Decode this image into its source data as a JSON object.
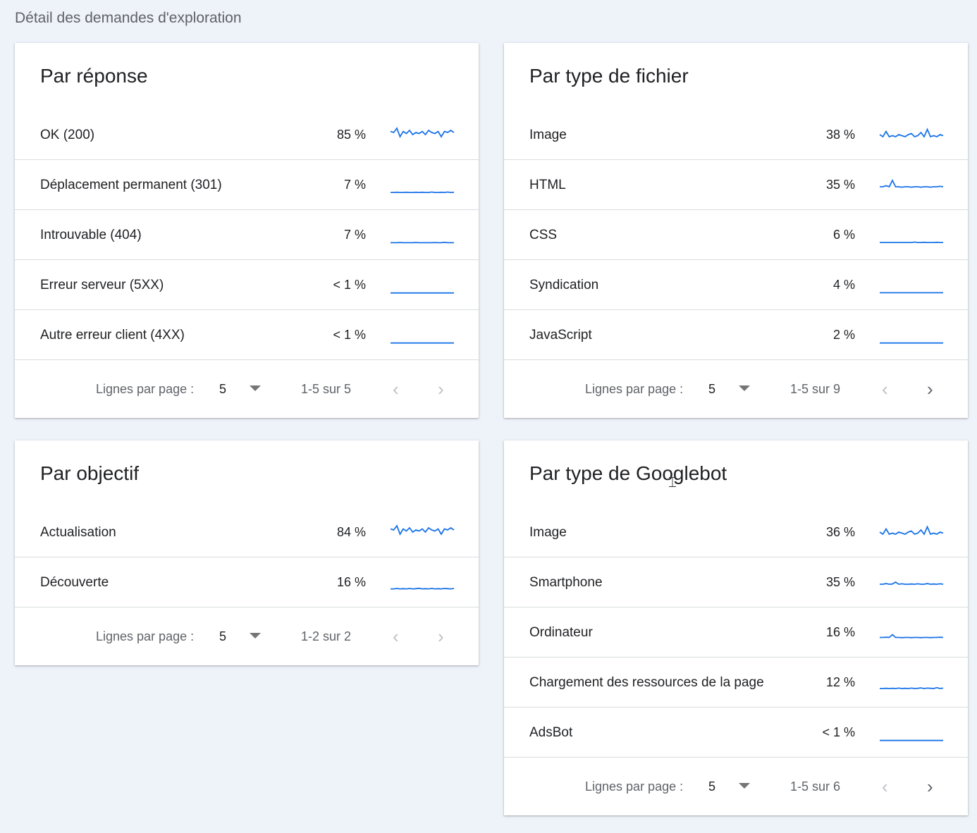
{
  "page_title": "Détail des demandes d'exploration",
  "accent_color": "#1a73e8",
  "cards": [
    {
      "title": "Par réponse",
      "rows": [
        {
          "label": "OK (200)",
          "pct": "85 %",
          "trend": [
            0.55,
            0.5,
            0.7,
            0.3,
            0.55,
            0.45,
            0.6,
            0.4,
            0.5,
            0.45,
            0.55,
            0.4,
            0.6,
            0.5,
            0.45,
            0.55,
            0.3,
            0.55,
            0.5,
            0.6,
            0.5
          ]
        },
        {
          "label": "Déplacement permanent (301)",
          "pct": "7 %",
          "trend": [
            0.03,
            0.03,
            0.04,
            0.03,
            0.03,
            0.04,
            0.03,
            0.03,
            0.04,
            0.03,
            0.04,
            0.03,
            0.03,
            0.05,
            0.03,
            0.03,
            0.04,
            0.03,
            0.05,
            0.03,
            0.04
          ]
        },
        {
          "label": "Introuvable (404)",
          "pct": "7 %",
          "trend": [
            0.02,
            0.02,
            0.02,
            0.03,
            0.02,
            0.02,
            0.02,
            0.02,
            0.03,
            0.02,
            0.02,
            0.02,
            0.02,
            0.02,
            0.03,
            0.02,
            0.02,
            0.04,
            0.02,
            0.02,
            0.02
          ]
        },
        {
          "label": "Erreur serveur (5XX)",
          "pct": "< 1 %",
          "trend": [
            0.01,
            0.01,
            0.01,
            0.01,
            0.01,
            0.01,
            0.01,
            0.01,
            0.01,
            0.01,
            0.01,
            0.01,
            0.01,
            0.01,
            0.01,
            0.01,
            0.01,
            0.01,
            0.01,
            0.01,
            0.01
          ]
        },
        {
          "label": "Autre erreur client (4XX)",
          "pct": "< 1 %",
          "trend": [
            0.01,
            0.01,
            0.01,
            0.01,
            0.01,
            0.01,
            0.01,
            0.01,
            0.01,
            0.01,
            0.01,
            0.01,
            0.01,
            0.01,
            0.01,
            0.01,
            0.01,
            0.01,
            0.01,
            0.01,
            0.01
          ]
        }
      ],
      "footer": {
        "rows_label": "Lignes par page :",
        "rows_value": "5",
        "range": "1-5 sur 5",
        "next_enabled": false
      }
    },
    {
      "title": "Par type de fichier",
      "rows": [
        {
          "label": "Image",
          "pct": "38 %",
          "trend": [
            0.4,
            0.3,
            0.55,
            0.3,
            0.35,
            0.3,
            0.4,
            0.35,
            0.3,
            0.4,
            0.45,
            0.3,
            0.35,
            0.5,
            0.3,
            0.65,
            0.3,
            0.35,
            0.3,
            0.4,
            0.35
          ]
        },
        {
          "label": "HTML",
          "pct": "35 %",
          "trend": [
            0.3,
            0.3,
            0.35,
            0.3,
            0.6,
            0.3,
            0.3,
            0.28,
            0.3,
            0.3,
            0.28,
            0.3,
            0.3,
            0.28,
            0.3,
            0.3,
            0.28,
            0.3,
            0.3,
            0.32,
            0.3
          ]
        },
        {
          "label": "CSS",
          "pct": "6 %",
          "trend": [
            0.03,
            0.03,
            0.03,
            0.03,
            0.03,
            0.03,
            0.03,
            0.03,
            0.03,
            0.03,
            0.03,
            0.05,
            0.03,
            0.03,
            0.04,
            0.03,
            0.03,
            0.03,
            0.04,
            0.03,
            0.03
          ]
        },
        {
          "label": "Syndication",
          "pct": "4 %",
          "trend": [
            0.02,
            0.02,
            0.02,
            0.02,
            0.02,
            0.02,
            0.02,
            0.02,
            0.02,
            0.02,
            0.02,
            0.02,
            0.02,
            0.02,
            0.02,
            0.02,
            0.02,
            0.02,
            0.02,
            0.02,
            0.02
          ]
        },
        {
          "label": "JavaScript",
          "pct": "2 %",
          "trend": [
            0.01,
            0.01,
            0.01,
            0.01,
            0.01,
            0.01,
            0.01,
            0.01,
            0.01,
            0.01,
            0.01,
            0.01,
            0.01,
            0.01,
            0.01,
            0.01,
            0.01,
            0.01,
            0.01,
            0.01,
            0.01
          ]
        }
      ],
      "footer": {
        "rows_label": "Lignes par page :",
        "rows_value": "5",
        "range": "1-5 sur 9",
        "next_enabled": true
      }
    },
    {
      "title": "Par objectif",
      "rows": [
        {
          "label": "Actualisation",
          "pct": "84 %",
          "trend": [
            0.55,
            0.5,
            0.7,
            0.3,
            0.55,
            0.45,
            0.6,
            0.4,
            0.5,
            0.45,
            0.55,
            0.4,
            0.6,
            0.5,
            0.45,
            0.55,
            0.3,
            0.55,
            0.5,
            0.6,
            0.5
          ]
        },
        {
          "label": "Découverte",
          "pct": "16 %",
          "trend": [
            0.08,
            0.08,
            0.1,
            0.08,
            0.09,
            0.08,
            0.1,
            0.08,
            0.09,
            0.11,
            0.08,
            0.09,
            0.08,
            0.1,
            0.08,
            0.09,
            0.08,
            0.1,
            0.09,
            0.08,
            0.1
          ]
        }
      ],
      "footer": {
        "rows_label": "Lignes par page :",
        "rows_value": "5",
        "range": "1-2 sur 2",
        "next_enabled": false
      }
    },
    {
      "title": "Par type de Googlebot",
      "rows": [
        {
          "label": "Image",
          "pct": "36 %",
          "trend": [
            0.4,
            0.3,
            0.55,
            0.3,
            0.35,
            0.3,
            0.4,
            0.35,
            0.3,
            0.4,
            0.45,
            0.3,
            0.35,
            0.5,
            0.3,
            0.65,
            0.3,
            0.35,
            0.3,
            0.4,
            0.35
          ]
        },
        {
          "label": "Smartphone",
          "pct": "35 %",
          "trend": [
            0.3,
            0.3,
            0.33,
            0.3,
            0.31,
            0.4,
            0.3,
            0.32,
            0.3,
            0.3,
            0.31,
            0.3,
            0.32,
            0.3,
            0.3,
            0.33,
            0.3,
            0.31,
            0.3,
            0.32,
            0.3
          ]
        },
        {
          "label": "Ordinateur",
          "pct": "16 %",
          "trend": [
            0.15,
            0.15,
            0.16,
            0.15,
            0.28,
            0.15,
            0.15,
            0.14,
            0.15,
            0.15,
            0.14,
            0.15,
            0.15,
            0.14,
            0.15,
            0.15,
            0.14,
            0.15,
            0.15,
            0.16,
            0.15
          ]
        },
        {
          "label": "Chargement des ressources de la page",
          "pct": "12 %",
          "trend": [
            0.1,
            0.1,
            0.11,
            0.1,
            0.11,
            0.1,
            0.12,
            0.1,
            0.11,
            0.1,
            0.12,
            0.1,
            0.11,
            0.13,
            0.1,
            0.12,
            0.11,
            0.1,
            0.14,
            0.1,
            0.12
          ]
        },
        {
          "label": "AdsBot",
          "pct": "< 1 %",
          "trend": [
            0.01,
            0.01,
            0.01,
            0.01,
            0.01,
            0.01,
            0.01,
            0.01,
            0.01,
            0.01,
            0.01,
            0.01,
            0.01,
            0.01,
            0.01,
            0.01,
            0.01,
            0.01,
            0.01,
            0.01,
            0.01
          ]
        }
      ],
      "footer": {
        "rows_label": "Lignes par page :",
        "rows_value": "5",
        "range": "1-5 sur 6",
        "next_enabled": true
      }
    }
  ]
}
